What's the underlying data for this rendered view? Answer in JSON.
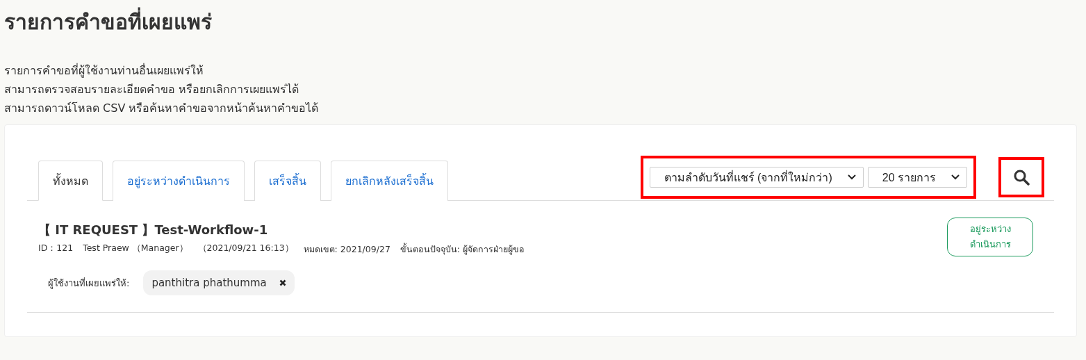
{
  "page": {
    "title": "รายการคำขอที่เผยแพร่",
    "description": [
      "รายการคำขอที่ผู้ใช้งานท่านอื่นเผยแพร่ให้",
      "สามารถตรวจสอบรายละเอียดคำขอ หรือยกเลิกการเผยแพร่ได้",
      "สามารถดาวน์โหลด CSV หรือค้นหาคำขอจากหน้าค้นหาคำขอได้"
    ]
  },
  "tabs": [
    {
      "label": "ทั้งหมด",
      "selected": true
    },
    {
      "label": "อยู่ระหว่างดำเนินการ",
      "selected": false
    },
    {
      "label": "เสร็จสิ้น",
      "selected": false
    },
    {
      "label": "ยกเลิกหลังเสร็จสิ้น",
      "selected": false
    }
  ],
  "controls": {
    "highlighted": true,
    "sort": "ตามลำดับวันที่แชร์ (จากที่ใหม่กว่า)",
    "page_size": "20 รายการ",
    "search_highlighted": true
  },
  "requests": [
    {
      "title": "【 IT REQUEST 】Test-Workflow-1",
      "meta": [
        "ID：121",
        "Test Praew （Manager）",
        "（2021/09/21 16:13）",
        "หมดเขต: 2021/09/27",
        "ขั้นตอนปัจจุบัน: ผู้จัดการฝ่ายผู้ขอ"
      ],
      "status": "อยู่ระหว่างดำเนินการ",
      "color": "#1a9a5c",
      "shared_label": "ผู้ใช้งานที่เผยแพร่ให้:",
      "shared_users": [
        "panthitra phathumma"
      ]
    }
  ]
}
